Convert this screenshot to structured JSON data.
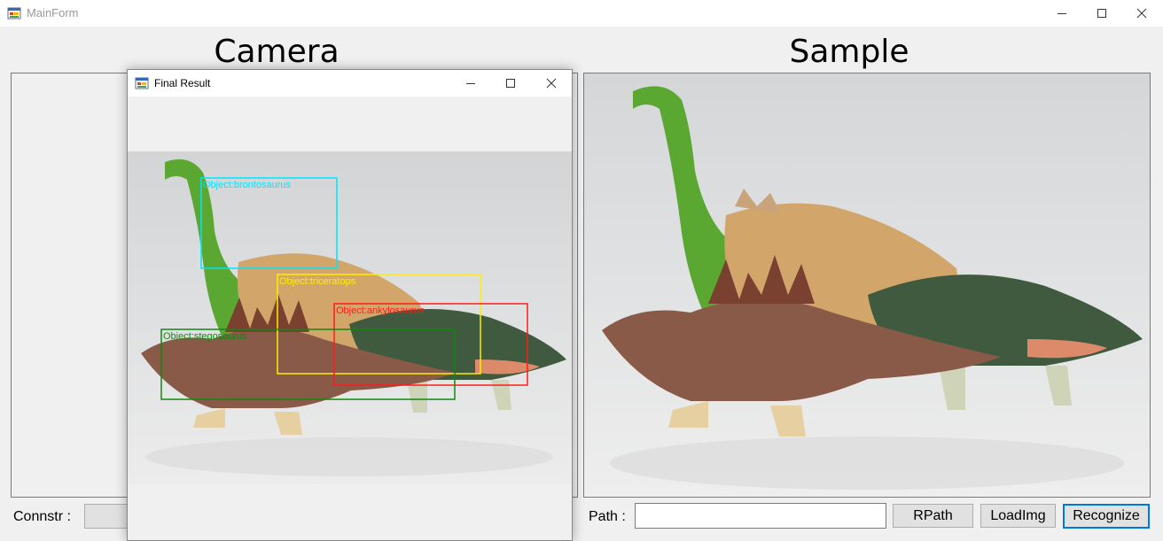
{
  "window": {
    "title": "MainForm",
    "icon": "winforms-app-icon"
  },
  "headings": {
    "camera": "Camera",
    "sample": "Sample"
  },
  "bottom": {
    "connstr_label": "Connstr :",
    "connstr_value": "",
    "path_label": "Path :",
    "path_value": "",
    "rpath_button": "RPath",
    "loadimg_button": "LoadImg",
    "recognize_button": "Recognize"
  },
  "dialog": {
    "title": "Final Result",
    "detections": [
      {
        "label": "Object:brontosaurus",
        "color": "#00e5ff"
      },
      {
        "label": "Object:triceratops",
        "color": "#ffee00"
      },
      {
        "label": "Object:ankylosaurus",
        "color": "#ff1a1a"
      },
      {
        "label": "Object:stegosaurus",
        "color": "#118811"
      }
    ]
  },
  "colors": {
    "accent": "#0078d7",
    "background": "#f0f0f0"
  }
}
